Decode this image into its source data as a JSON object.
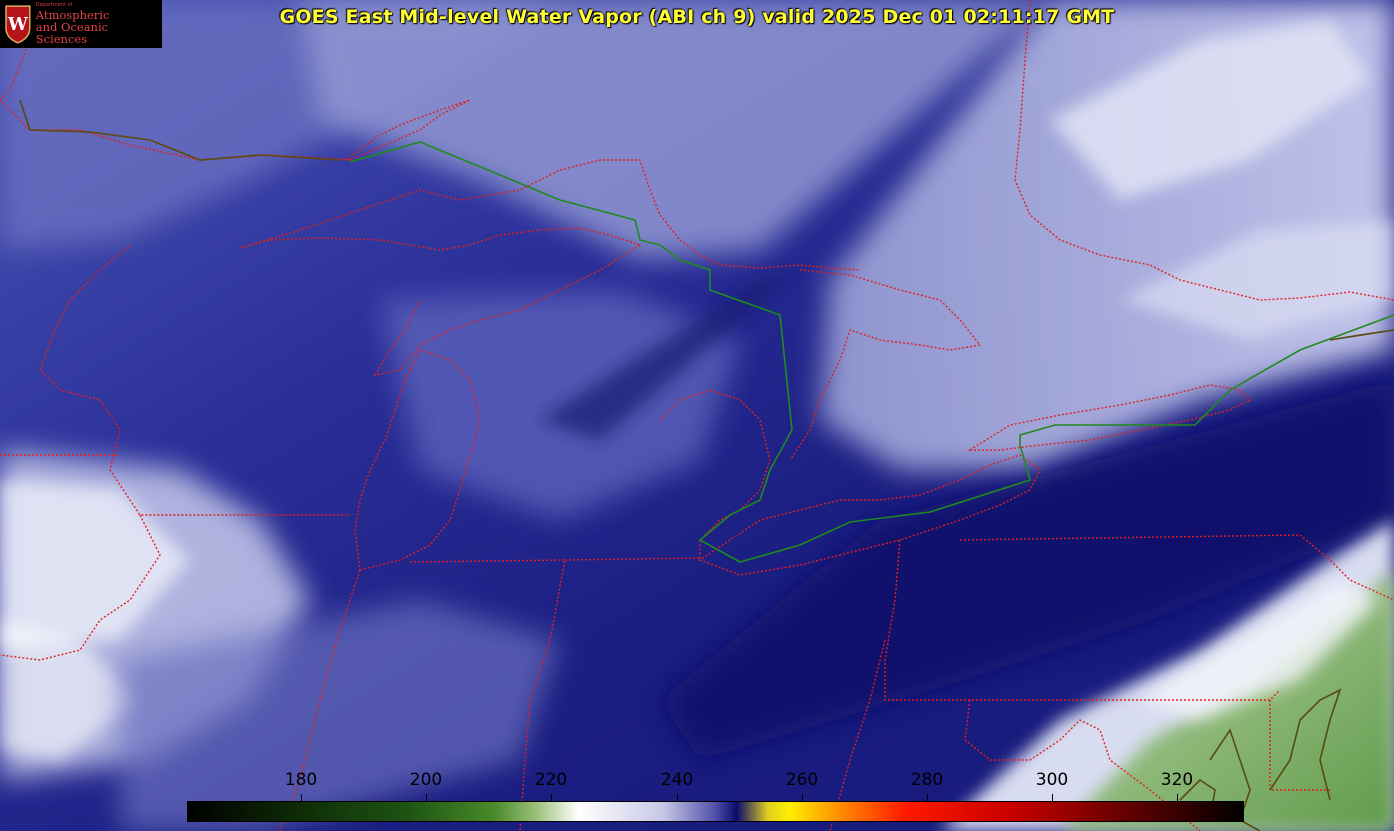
{
  "title": "GOES East Mid-level Water Vapor (ABI ch 9)  valid 2025 Dec 01 02:11:17 GMT",
  "logo": {
    "dept": "Department of",
    "line1": "Atmospheric",
    "line2": "and Oceanic Sciences",
    "crest_letter": "W"
  },
  "colorbar": {
    "ticks": [
      "180",
      "200",
      "220",
      "240",
      "260",
      "280",
      "300",
      "320"
    ]
  },
  "colors": {
    "title": "#ffff33",
    "state_borders": "#e02020",
    "us_canada_border": "#1f8a1f",
    "coastline": "#5a4a10"
  }
}
